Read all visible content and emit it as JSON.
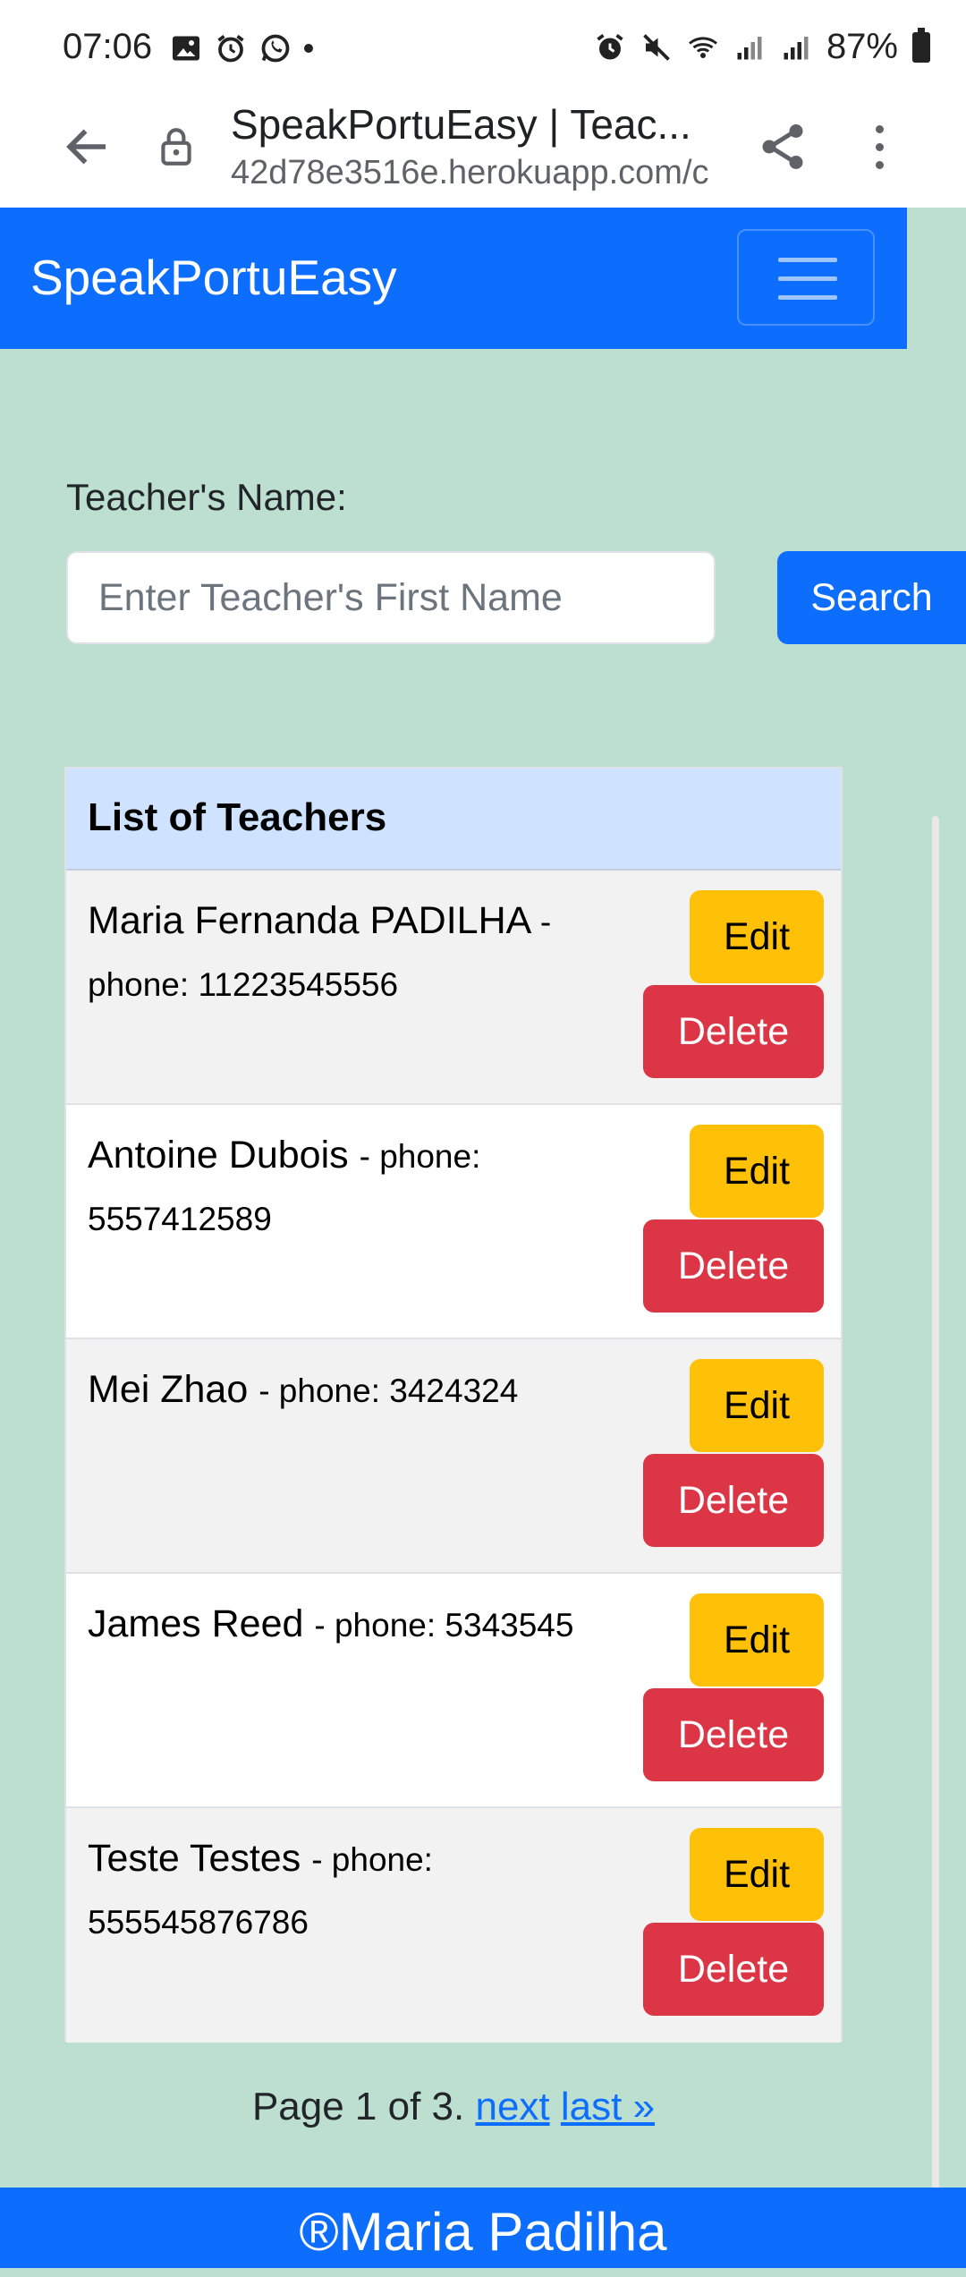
{
  "status_bar": {
    "time": "07:06",
    "battery": "87%",
    "left_icons": [
      "gallery-icon",
      "alarm-icon",
      "whatsapp-icon",
      "dot"
    ],
    "right_icons": [
      "alarm-icon",
      "mute-icon",
      "wifi-icon",
      "signal-icon",
      "signal-icon",
      "battery-icon"
    ]
  },
  "browser": {
    "page_title": "SpeakPortuEasy | Teac...",
    "url": "42d78e3516e.herokuapp.com/c"
  },
  "navbar": {
    "brand": "SpeakPortuEasy",
    "toggler_icon": "hamburger-icon",
    "color": "#0d6efd"
  },
  "search": {
    "label": "Teacher's Name:",
    "placeholder": "Enter Teacher's First Name",
    "value": "",
    "button_label": "Search"
  },
  "table": {
    "header": "List of Teachers",
    "edit_label": "Edit",
    "delete_label": "Delete",
    "rows": [
      {
        "name": "Maria Fernanda PADILHA",
        "phone": "- phone: 11223545556"
      },
      {
        "name": "Antoine Dubois",
        "phone": "- phone: 5557412589"
      },
      {
        "name": "Mei Zhao",
        "phone": "- phone: 3424324"
      },
      {
        "name": "James Reed",
        "phone": "- phone: 5343545"
      },
      {
        "name": "Teste Testes",
        "phone": "- phone: 555545876786"
      }
    ]
  },
  "pagination": {
    "text": "Page 1 of 3.",
    "next": "next",
    "last": "last »"
  },
  "footer": {
    "text": "®Maria Padilha"
  },
  "colors": {
    "background": "#bcdfcf",
    "primary": "#0d6efd",
    "warning": "#ffc107",
    "danger": "#dc3545",
    "table_header": "#cfe2ff"
  }
}
